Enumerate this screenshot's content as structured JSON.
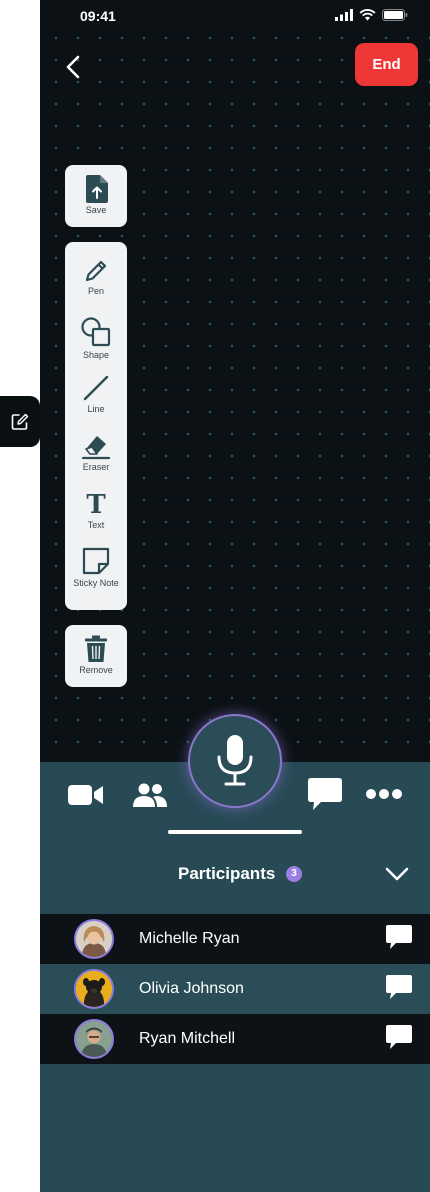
{
  "status_bar": {
    "time": "09:41"
  },
  "header": {
    "end_label": "End"
  },
  "tools": {
    "save": "Save",
    "pen": "Pen",
    "shape": "Shape",
    "line": "Line",
    "eraser": "Eraser",
    "text": "Text",
    "text_glyph": "T",
    "sticky": "Sticky Note",
    "remove": "Remove"
  },
  "colors": {
    "end": "#f03737",
    "accent": "#9b7fe6",
    "panel": "#274a55"
  },
  "participants": {
    "title": "Participants",
    "count": "3",
    "list": [
      {
        "name": "Michelle Ryan"
      },
      {
        "name": "Olivia Johnson"
      },
      {
        "name": "Ryan Mitchell"
      }
    ]
  }
}
